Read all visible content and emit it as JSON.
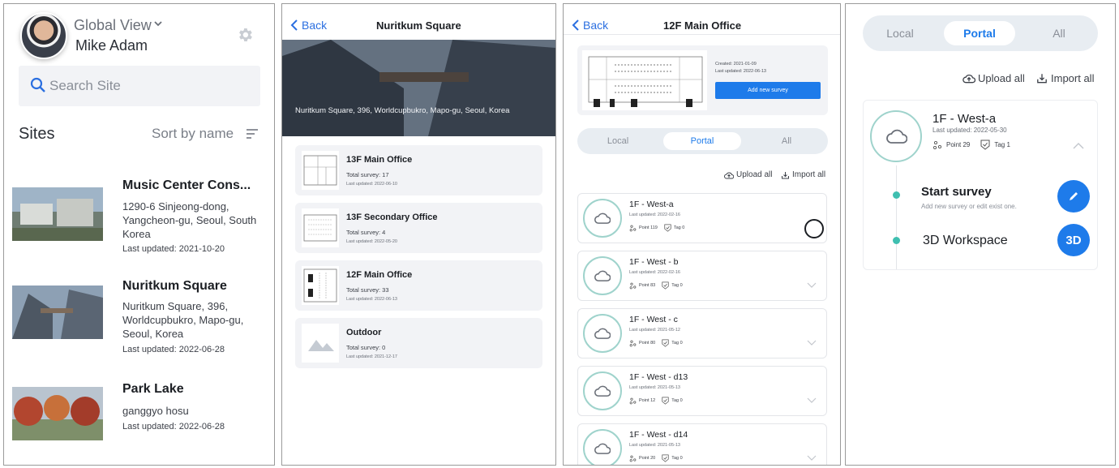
{
  "panel1": {
    "view_label": "Global View",
    "user_name": "Mike Adam",
    "search_placeholder": "Search Site",
    "sites_title": "Sites",
    "sort_label": "Sort by name",
    "sites": [
      {
        "name": "Music Center Cons...",
        "address": "1290-6 Sinjeong-dong, Yangcheon-gu, Seoul, South Korea",
        "last_updated": "Last updated: 2021-10-20"
      },
      {
        "name": "Nuritkum Square",
        "address": "Nuritkum Square, 396, Worldcupbukro, Mapo-gu, Seoul, Korea",
        "last_updated": "Last updated: 2022-06-28"
      },
      {
        "name": "Park Lake",
        "address": "ganggyo hosu",
        "last_updated": "Last updated: 2022-06-28"
      }
    ]
  },
  "panel2": {
    "back_label": "Back",
    "title": "Nuritkum Square",
    "hero_address": "Nuritkum Square, 396, Worldcupbukro, Mapo-gu, Seoul, Korea",
    "floors": [
      {
        "name": "13F Main Office",
        "count": "Total survey: 17",
        "date": "Last updated: 2022-06-10"
      },
      {
        "name": "13F Secondary Office",
        "count": "Total survey: 4",
        "date": "Last updated: 2022-05-20"
      },
      {
        "name": "12F Main Office",
        "count": "Total survey: 33",
        "date": "Last updated: 2022-06-13"
      },
      {
        "name": "Outdoor",
        "count": "Total survey: 0",
        "date": "Last updated: 2021-12-17"
      }
    ]
  },
  "panel3": {
    "back_label": "Back",
    "title": "12F Main Office",
    "created": "Created: 2021-01-09",
    "updated": "Last updated: 2022-06-13",
    "add_button": "Add new survey",
    "tabs": [
      "Local",
      "Portal",
      "All"
    ],
    "active_tab": "Portal",
    "upload_all": "Upload all",
    "import_all": "Import all",
    "surveys": [
      {
        "title": "1F - West-a",
        "date": "Last updated: 2022-02-16",
        "point": "Point 119",
        "tag": "Tag 0"
      },
      {
        "title": "1F - West - b",
        "date": "Last updated: 2022-02-16",
        "point": "Point 83",
        "tag": "Tag 0"
      },
      {
        "title": "1F - West - c",
        "date": "Last updated: 2021-05-12",
        "point": "Point 80",
        "tag": "Tag 0"
      },
      {
        "title": "1F - West - d13",
        "date": "Last updated: 2021-05-13",
        "point": "Point 12",
        "tag": "Tag 0"
      },
      {
        "title": "1F - West - d14",
        "date": "Last updated: 2021-05-13",
        "point": "Point 20",
        "tag": "Tag 0"
      }
    ]
  },
  "panel4": {
    "tabs": [
      "Local",
      "Portal",
      "All"
    ],
    "active_tab": "Portal",
    "upload_all": "Upload all",
    "import_all": "Import all",
    "survey": {
      "title": "1F - West-a",
      "date": "Last updated: 2022-05-30",
      "point": "Point 29",
      "tag": "Tag 1"
    },
    "start_survey": "Start survey",
    "start_survey_sub": "Add new survey or edit exist one.",
    "workspace": "3D Workspace",
    "workspace_button": "3D"
  },
  "colors": {
    "accent": "#1e7bea",
    "teal": "#3fbfb0",
    "card_bg": "#f2f3f6"
  }
}
